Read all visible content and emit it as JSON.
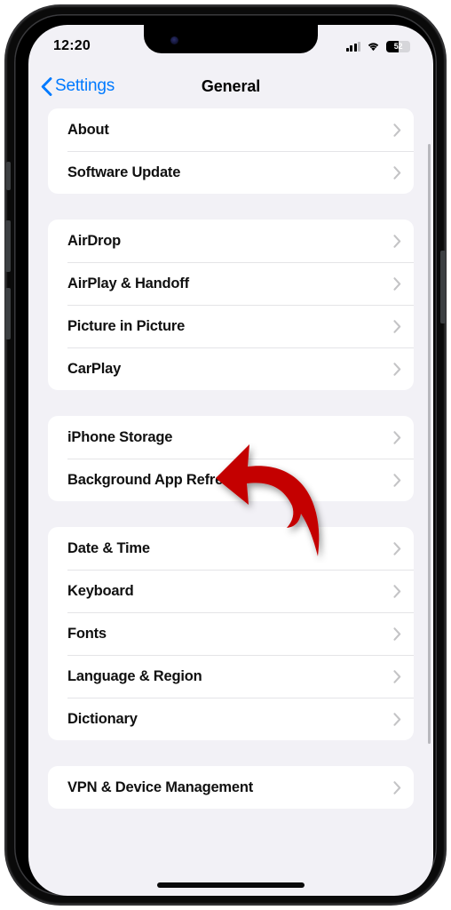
{
  "status_bar": {
    "time": "12:20",
    "cellular_icon": "cellular-signal-icon",
    "wifi_icon": "wifi-icon",
    "battery_percent_text": "52",
    "battery_level": 52
  },
  "nav_bar": {
    "back_label": "Settings",
    "back_icon": "chevron-left-icon",
    "title": "General"
  },
  "colors": {
    "accent_blue": "#007aff",
    "background": "#f2f1f6",
    "card": "#ffffff",
    "separator": "#e4e4e7",
    "chevron": "#c4c4c6",
    "annotation_red": "#c40000"
  },
  "annotation": {
    "type": "curved-arrow",
    "color": "#c40000",
    "points_to": "iPhone Storage",
    "direction": "left"
  },
  "groups": [
    {
      "rows": [
        {
          "label": "About",
          "chevron": "chevron-right-icon"
        },
        {
          "label": "Software Update",
          "chevron": "chevron-right-icon"
        }
      ]
    },
    {
      "rows": [
        {
          "label": "AirDrop",
          "chevron": "chevron-right-icon"
        },
        {
          "label": "AirPlay & Handoff",
          "chevron": "chevron-right-icon"
        },
        {
          "label": "Picture in Picture",
          "chevron": "chevron-right-icon"
        },
        {
          "label": "CarPlay",
          "chevron": "chevron-right-icon"
        }
      ]
    },
    {
      "rows": [
        {
          "label": "iPhone Storage",
          "chevron": "chevron-right-icon"
        },
        {
          "label": "Background App Refresh",
          "chevron": "chevron-right-icon"
        }
      ]
    },
    {
      "rows": [
        {
          "label": "Date & Time",
          "chevron": "chevron-right-icon"
        },
        {
          "label": "Keyboard",
          "chevron": "chevron-right-icon"
        },
        {
          "label": "Fonts",
          "chevron": "chevron-right-icon"
        },
        {
          "label": "Language & Region",
          "chevron": "chevron-right-icon"
        },
        {
          "label": "Dictionary",
          "chevron": "chevron-right-icon"
        }
      ]
    },
    {
      "rows": [
        {
          "label": "VPN & Device Management",
          "chevron": "chevron-right-icon"
        }
      ]
    }
  ]
}
